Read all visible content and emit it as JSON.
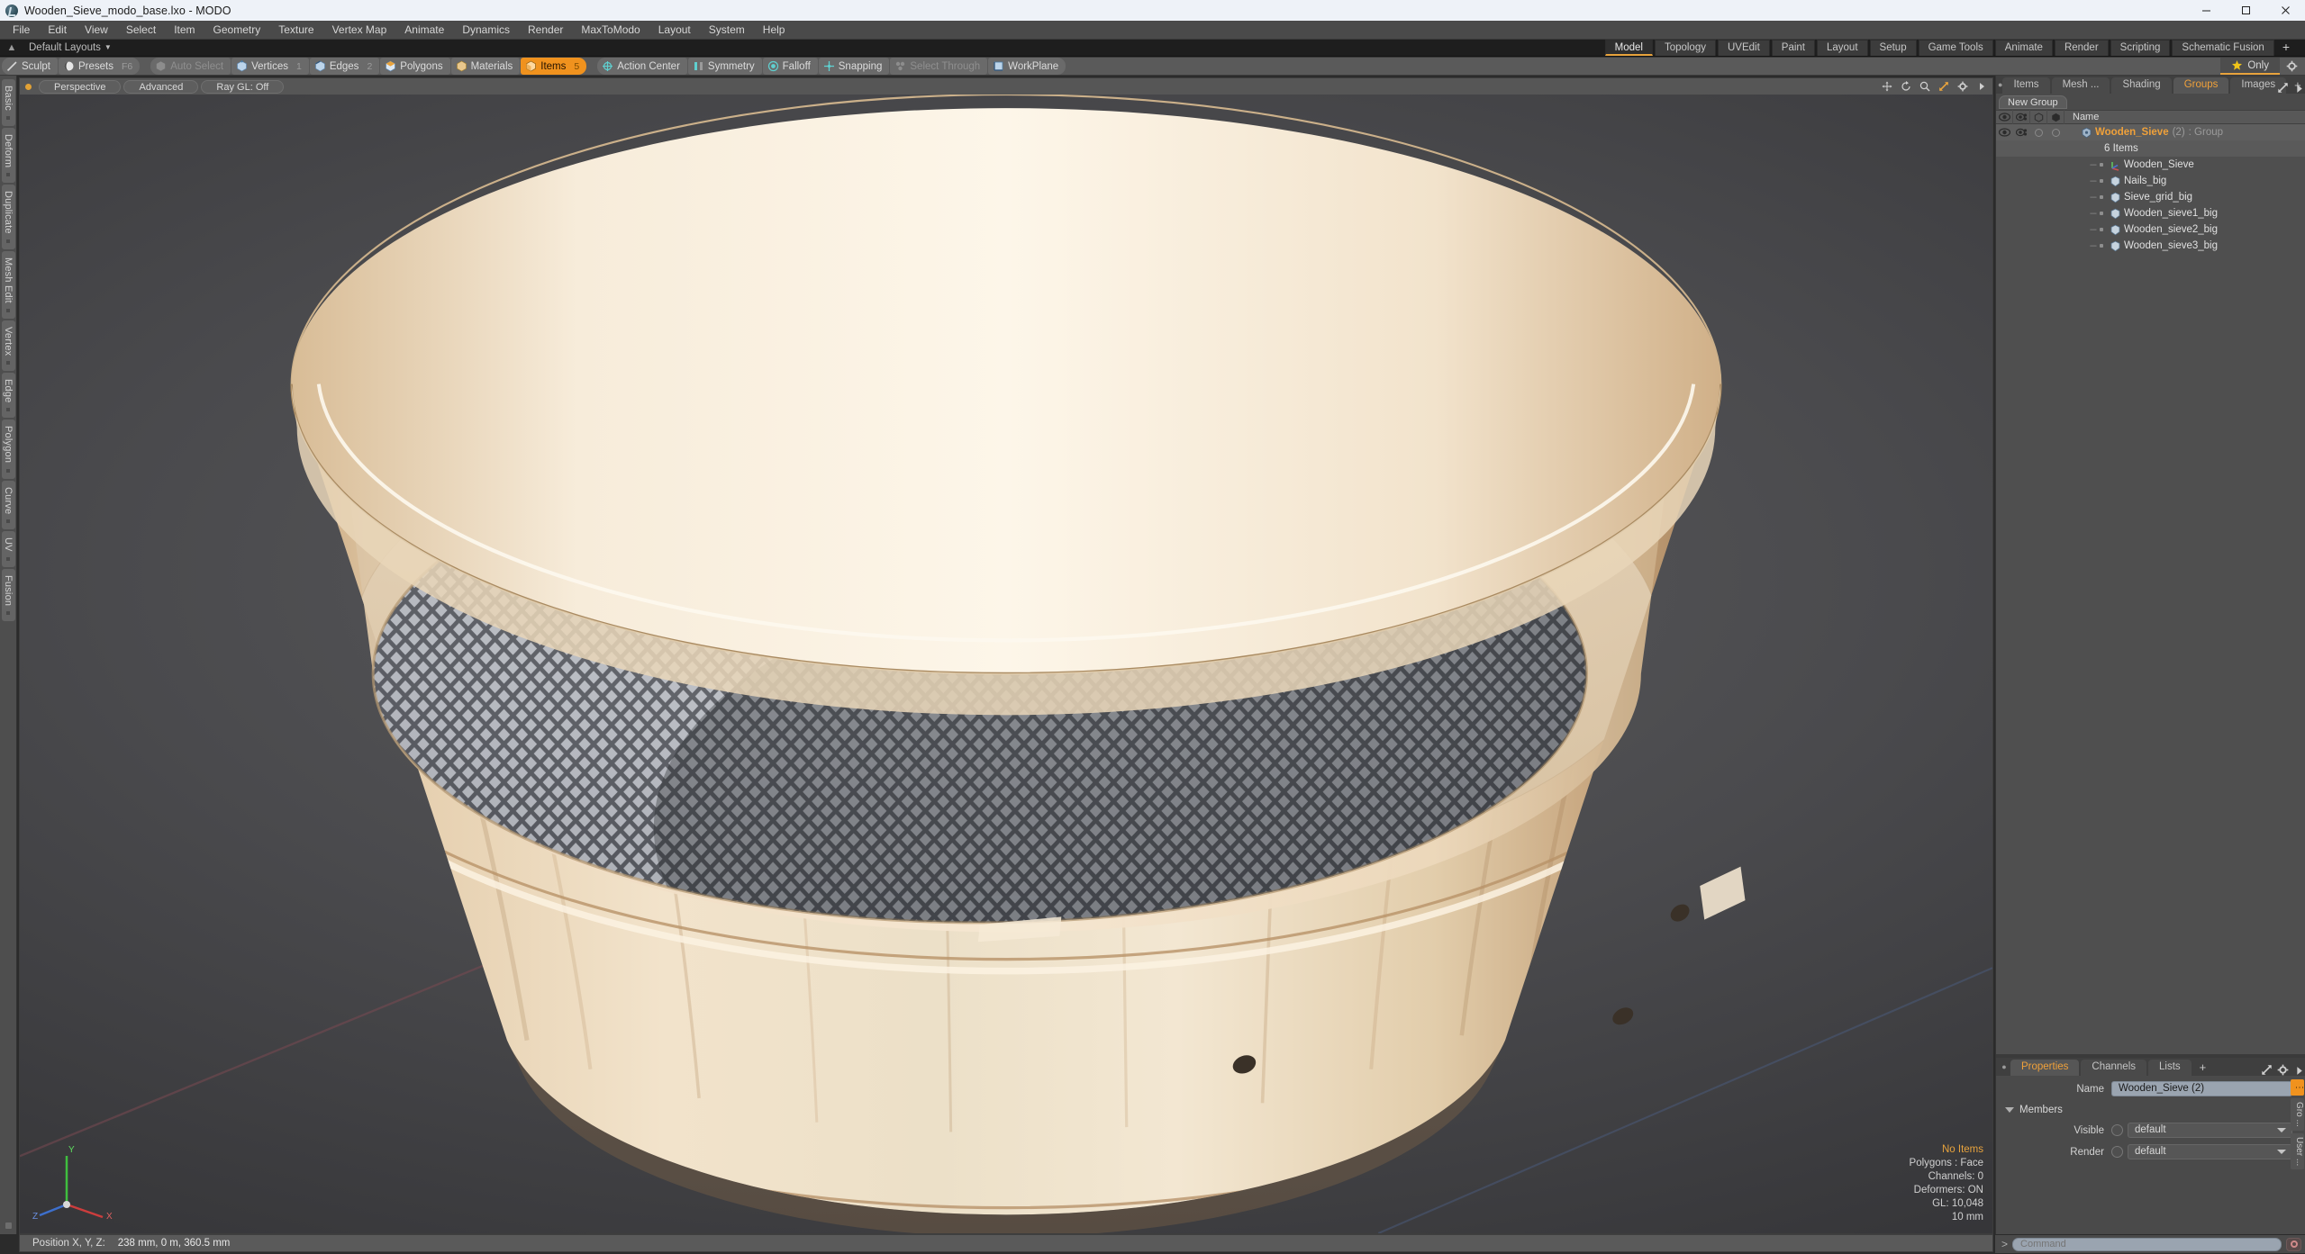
{
  "window": {
    "title": "Wooden_Sieve_modo_base.lxo - MODO",
    "minimize": "—",
    "maximize": "☐",
    "close": "✕"
  },
  "menubar": {
    "items": [
      "File",
      "Edit",
      "View",
      "Select",
      "Item",
      "Geometry",
      "Texture",
      "Vertex Map",
      "Animate",
      "Dynamics",
      "Render",
      "MaxToModo",
      "Layout",
      "System",
      "Help"
    ]
  },
  "layoutbar": {
    "name": "Default Layouts"
  },
  "mode_tabs": {
    "items": [
      {
        "label": "Model",
        "active": true
      },
      {
        "label": "Topology",
        "active": false
      },
      {
        "label": "UVEdit",
        "active": false
      },
      {
        "label": "Paint",
        "active": false
      },
      {
        "label": "Layout",
        "active": false
      },
      {
        "label": "Setup",
        "active": false
      },
      {
        "label": "Game Tools",
        "active": false
      },
      {
        "label": "Animate",
        "active": false
      },
      {
        "label": "Render",
        "active": false
      },
      {
        "label": "Scripting",
        "active": false
      },
      {
        "label": "Schematic Fusion",
        "active": false
      }
    ],
    "add_label": "+"
  },
  "toolbar": {
    "sculpt": "Sculpt",
    "presets": "Presets",
    "presets_key": "F6",
    "auto_select": "Auto Select",
    "vertices": "Vertices",
    "vertices_key": "1",
    "edges": "Edges",
    "edges_key": "2",
    "polygons": "Polygons",
    "materials": "Materials",
    "items": "Items",
    "items_key": "5",
    "action_center": "Action Center",
    "symmetry": "Symmetry",
    "falloff": "Falloff",
    "snapping": "Snapping",
    "select_through": "Select Through",
    "workplane": "WorkPlane",
    "only": "Only"
  },
  "left_tabs": {
    "items": [
      "Basic",
      "Deform",
      "Duplicate",
      "Mesh Edit",
      "Vertex",
      "Edge",
      "Polygon",
      "Curve",
      "UV",
      "Fusion"
    ]
  },
  "viewport": {
    "header": {
      "view_mode": "Perspective",
      "shading": "Advanced",
      "raygl": "Ray GL: Off"
    },
    "stats": {
      "selection": "No Items",
      "polygons": "Polygons : Face",
      "channels": "Channels: 0",
      "deformers": "Deformers: ON",
      "gl": "GL: 10,048",
      "grid": "10 mm"
    },
    "axis": {
      "x": "X",
      "y": "Y",
      "z": "Z"
    }
  },
  "right_panel": {
    "tabs": [
      {
        "label": "Items",
        "active": false
      },
      {
        "label": "Mesh ...",
        "active": false
      },
      {
        "label": "Shading",
        "active": false
      },
      {
        "label": "Groups",
        "active": true
      },
      {
        "label": "Images",
        "active": false
      }
    ],
    "add_label": "+",
    "new_group_button": "New Group",
    "list_header_name": "Name",
    "group": {
      "name": "Wooden_Sieve",
      "count": "(2)",
      "type": ": Group",
      "sub": "6 Items"
    },
    "items": [
      {
        "label": "Wooden_Sieve",
        "icon": "locator-icon"
      },
      {
        "label": "Nails_big",
        "icon": "mesh-icon"
      },
      {
        "label": "Sieve_grid_big",
        "icon": "mesh-icon"
      },
      {
        "label": "Wooden_sieve1_big",
        "icon": "mesh-icon"
      },
      {
        "label": "Wooden_sieve2_big",
        "icon": "mesh-icon"
      },
      {
        "label": "Wooden_sieve3_big",
        "icon": "mesh-icon"
      }
    ]
  },
  "properties": {
    "tabs": [
      {
        "label": "Properties",
        "active": true
      },
      {
        "label": "Channels",
        "active": false
      },
      {
        "label": "Lists",
        "active": false
      }
    ],
    "add_label": "+",
    "name_label": "Name",
    "name_value": "Wooden_Sieve (2)",
    "members_label": "Members",
    "visible_label": "Visible",
    "visible_value": "default",
    "render_label": "Render",
    "render_value": "default",
    "side_tabs": [
      "Gro ...",
      "User ..."
    ]
  },
  "statusbar": {
    "position_label": "Position X, Y, Z:",
    "position_value": "238 mm, 0 m, 360.5 mm"
  },
  "command": {
    "prompt": ">",
    "placeholder": "Command"
  },
  "colors": {
    "accent": "#f0921e",
    "tab_active_text": "#f0a13a",
    "panel_bg": "#4a4a4a",
    "toolbar_bg": "#5a5a5a"
  }
}
